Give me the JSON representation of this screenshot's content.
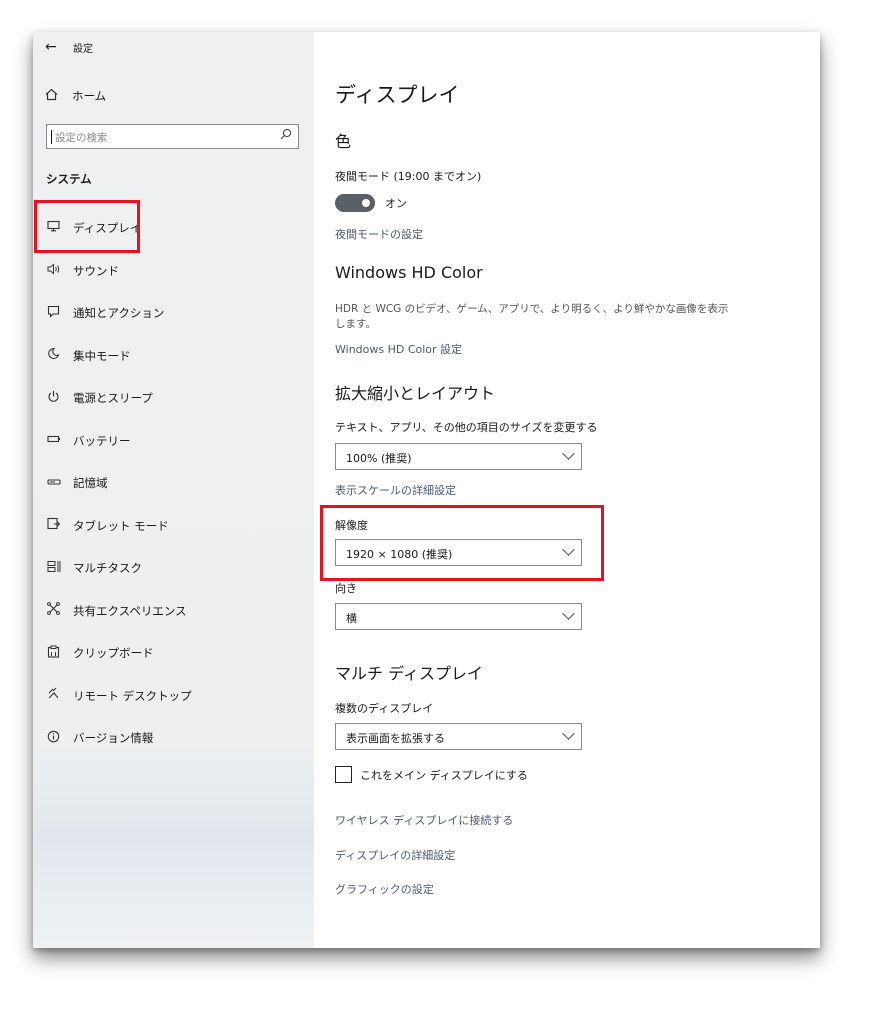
{
  "sidebar": {
    "back_icon": "arrow-left-icon",
    "title": "設定",
    "home": {
      "icon": "home-icon",
      "label": "ホーム"
    },
    "search": {
      "placeholder": "設定の検索",
      "icon": "search-icon"
    },
    "section": "システム",
    "items": [
      {
        "icon": "monitor-icon",
        "label": "ディスプレイ",
        "selected": true
      },
      {
        "icon": "speaker-icon",
        "label": "サウンド"
      },
      {
        "icon": "notification-icon",
        "label": "通知とアクション"
      },
      {
        "icon": "moon-icon",
        "label": "集中モード"
      },
      {
        "icon": "power-icon",
        "label": "電源とスリープ"
      },
      {
        "icon": "battery-icon",
        "label": "バッテリー"
      },
      {
        "icon": "storage-icon",
        "label": "記憶域"
      },
      {
        "icon": "tablet-mode-icon",
        "label": "タブレット モード"
      },
      {
        "icon": "multitask-icon",
        "label": "マルチタスク"
      },
      {
        "icon": "shared-experiences-icon",
        "label": "共有エクスペリエンス"
      },
      {
        "icon": "clipboard-icon",
        "label": "クリップボード"
      },
      {
        "icon": "remote-desktop-icon",
        "label": "リモート デスクトップ"
      },
      {
        "icon": "info-icon",
        "label": "バージョン情報"
      }
    ]
  },
  "main": {
    "page_title": "ディスプレイ",
    "color": {
      "heading": "色",
      "night_light_label": "夜間モード (19:00 までオン)",
      "toggle_state": "オン",
      "night_light_settings_link": "夜間モードの設定"
    },
    "hdr": {
      "heading": "Windows HD Color",
      "description": "HDR と WCG のビデオ、ゲーム、アプリで、より明るく、より鮮やかな画像を表示します。",
      "settings_link": "Windows HD Color 設定"
    },
    "scale_layout": {
      "heading": "拡大縮小とレイアウト",
      "scale_label": "テキスト、アプリ、その他の項目のサイズを変更する",
      "scale_value": "100% (推奨)",
      "advanced_scaling_link": "表示スケールの詳細設定",
      "resolution_label": "解像度",
      "resolution_value": "1920 × 1080 (推奨)",
      "orientation_label": "向き",
      "orientation_value": "横"
    },
    "multi_display": {
      "heading": "マルチ ディスプレイ",
      "multiple_label": "複数のディスプレイ",
      "multiple_value": "表示画面を拡張する",
      "main_display_checkbox": "これをメイン ディスプレイにする",
      "links": [
        "ワイヤレス ディスプレイに接続する",
        "ディスプレイの詳細設定",
        "グラフィックの設定"
      ]
    }
  },
  "colors": {
    "highlight": "#e8121d",
    "toggle_on": "#5a6068",
    "link": "#4a5a70"
  }
}
